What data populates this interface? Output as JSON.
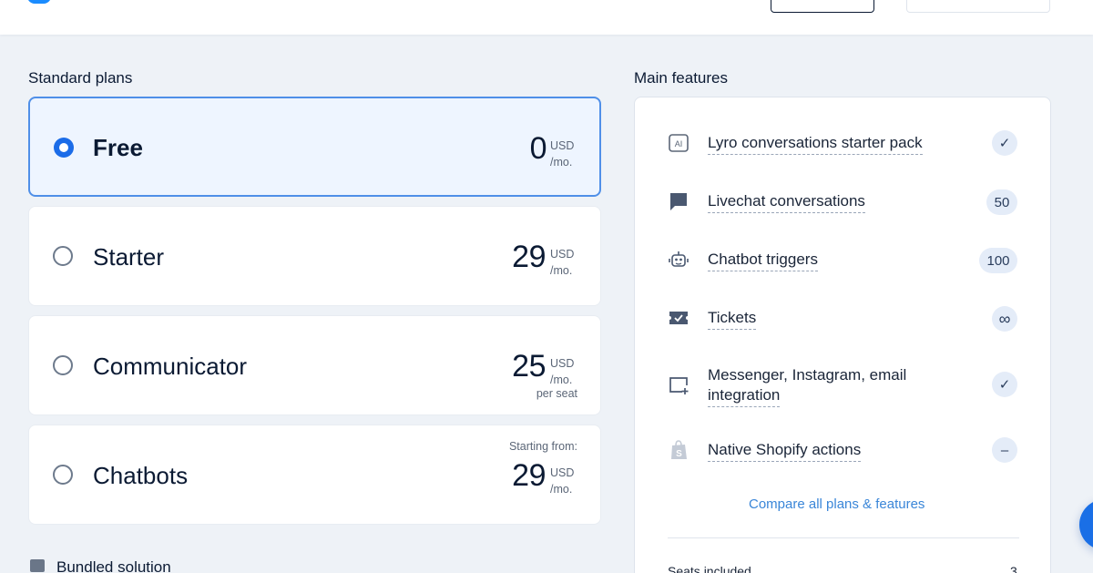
{
  "sections": {
    "plans_title": "Standard plans",
    "features_title": "Main features"
  },
  "plans": [
    {
      "name": "Free",
      "price": "0",
      "currency": "USD",
      "period": "/mo.",
      "note": "",
      "prefix": "",
      "selected": true
    },
    {
      "name": "Starter",
      "price": "29",
      "currency": "USD",
      "period": "/mo.",
      "note": "",
      "prefix": "",
      "selected": false
    },
    {
      "name": "Communicator",
      "price": "25",
      "currency": "USD",
      "period": "/mo.",
      "note": "per seat",
      "prefix": "",
      "selected": false
    },
    {
      "name": "Chatbots",
      "price": "29",
      "currency": "USD",
      "period": "/mo.",
      "note": "",
      "prefix": "Starting from:",
      "selected": false
    }
  ],
  "bundled": {
    "label": "Bundled solution",
    "icon": "bundle-icon"
  },
  "features": [
    {
      "label": "Lyro conversations starter pack",
      "icon": "ai-icon",
      "badge": "✓",
      "disabled": false
    },
    {
      "label": "Livechat conversations",
      "icon": "chat-icon",
      "badge": "50",
      "disabled": false
    },
    {
      "label": "Chatbot triggers",
      "icon": "bot-icon",
      "badge": "100",
      "disabled": false
    },
    {
      "label": "Tickets",
      "icon": "ticket-icon",
      "badge": "∞",
      "disabled": false
    },
    {
      "label_line1": "Messenger, Instagram, email",
      "label_line2": "integration",
      "icon": "integration-icon",
      "badge": "✓",
      "disabled": false
    },
    {
      "label": "Native Shopify actions",
      "icon": "shopify-icon",
      "badge": "–",
      "disabled": true
    }
  ],
  "compare_link": "Compare all plans & features",
  "seats": {
    "label": "Seats included",
    "value": "3"
  },
  "colors": {
    "accent": "#1b6ce8",
    "link": "#3a86d8",
    "selected_bg": "#eef5ff"
  }
}
